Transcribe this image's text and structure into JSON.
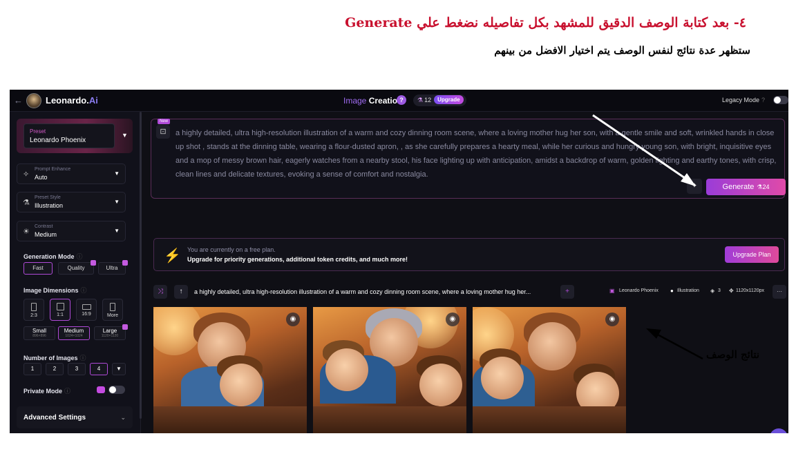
{
  "captions": {
    "step": "٤- بعد كتابة الوصف الدقيق للمشهد بكل تفاصيله نضغط علي Generate",
    "note": "ستظهر عدة نتائج لنفس الوصف يتم اختيار الافضل من بينهم",
    "results_label": "نتائج الوصف"
  },
  "header": {
    "back_icon": "←",
    "brand": "Leonardo.",
    "brand_suffix": "Ai",
    "title_prefix": "Image",
    "title_main": "Creation",
    "help": "?",
    "token_count": "12",
    "upgrade": "Upgrade",
    "legacy_label": "Legacy Mode",
    "legacy_q": "?"
  },
  "sidebar": {
    "preset_key": "Preset",
    "preset_value": "Leonardo Phoenix",
    "prompt_enhance_key": "Prompt Enhance",
    "prompt_enhance_value": "Auto",
    "preset_style_key": "Preset Style",
    "preset_style_value": "Illustration",
    "contrast_key": "Contrast",
    "contrast_value": "Medium",
    "generation_mode_label": "Generation Mode",
    "modes": [
      "Fast",
      "Quality",
      "Ultra"
    ],
    "image_dimensions_label": "Image Dimensions",
    "ratios": [
      "2:3",
      "1:1",
      "16:9",
      "More"
    ],
    "sizes": [
      {
        "label": "Small",
        "sub": "896×896"
      },
      {
        "label": "Medium",
        "sub": "1024×1024"
      },
      {
        "label": "Large",
        "sub": "1120×1120"
      }
    ],
    "num_images_label": "Number of Images",
    "num_options": [
      "1",
      "2",
      "3",
      "4"
    ],
    "private_mode_label": "Private Mode",
    "advanced_settings": "Advanced Settings"
  },
  "prompt": {
    "new_tag": "New",
    "text": "a highly detailed, ultra high-resolution illustration of a warm and cozy dinning room scene, where a loving mother hug her son, with a gentle smile and soft, wrinkled hands in close up shot , stands at the dinning table, wearing a flour-dusted apron, , as she carefully prepares a hearty meal, while her curious and hungry young son, with bright, inquisitive eyes and a mop of messy brown hair, eagerly watches from a nearby stool, his face lighting up with anticipation, amidst a backdrop of warm, golden lighting and earthy tones, with crisp, clean lines and delicate textures, evoking a sense of comfort and nostalgia.",
    "generate_label": "Generate",
    "generate_cost": "24"
  },
  "plan_banner": {
    "line1": "You are currently on a free plan.",
    "line2": "Upgrade for priority generations, additional token credits, and much more!",
    "button": "Upgrade Plan"
  },
  "generation": {
    "prompt_short": "a highly detailed, ultra high-resolution illustration of a warm and cozy dinning room scene, where a loving mother hug her...",
    "plus": "+",
    "model": "Leonardo Phoenix",
    "style": "Illustration",
    "count": "3",
    "dimensions": "1120x1120px",
    "more": "···"
  },
  "colors": {
    "caption_red": "#c8102e",
    "accent_purple": "#b04ad8",
    "bg_dark": "#0f0f15"
  }
}
